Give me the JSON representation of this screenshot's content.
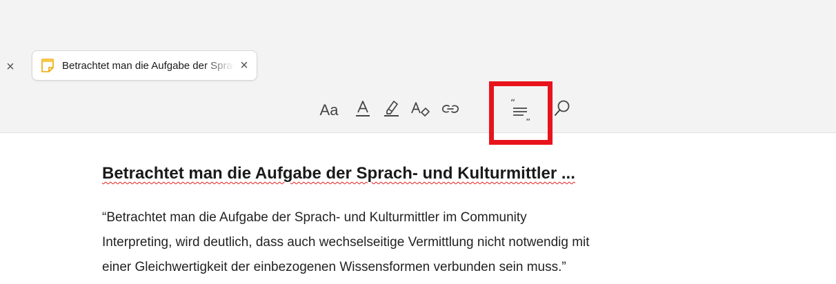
{
  "tabs": {
    "active_title": "Betrachtet man die Aufgabe der Sprach- und Kulturmittler ...",
    "close_glyph": "×",
    "previous_close_glyph": "×"
  },
  "toolbar": {
    "text_size_label": "Aa",
    "buttons": [
      {
        "name": "text-size-icon"
      },
      {
        "name": "text-color-icon"
      },
      {
        "name": "highlight-icon"
      },
      {
        "name": "clear-formatting-icon"
      },
      {
        "name": "link-icon"
      },
      {
        "name": "quote-icon"
      },
      {
        "name": "search-icon"
      }
    ],
    "highlighted_button": "quote-icon",
    "highlight_color": "#e8141c"
  },
  "note": {
    "heading": "Betrachtet man die Aufgabe der Sprach- und Kulturmittler ...",
    "quote_lines": [
      "“Betrachtet man die Aufgabe der Sprach- und Kulturmittler im Community",
      "Interpreting, wird deutlich, dass auch wechselseitige Vermittlung nicht notwendig mit",
      "einer Gleichwertigkeit der einbezogenen Wissensformen verbunden sein muss.”"
    ]
  }
}
